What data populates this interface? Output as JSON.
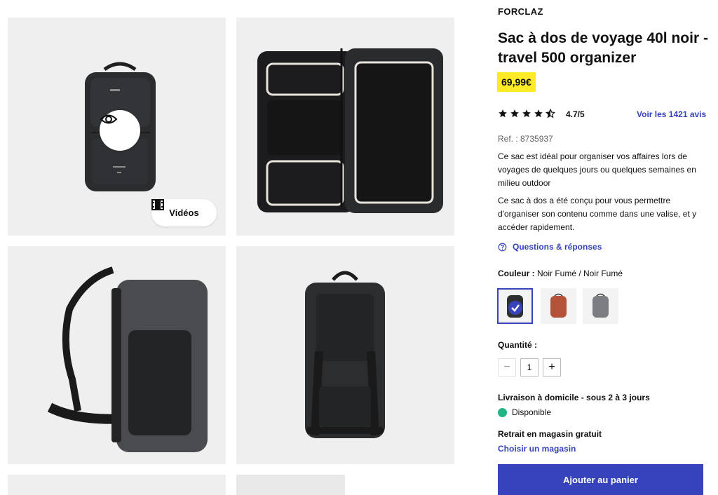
{
  "gallery": {
    "videos_label": "Vidéos"
  },
  "product": {
    "brand": "FORCLAZ",
    "title": "Sac à dos de voyage 40l noir - travel 500 organizer",
    "price": "69,99€",
    "rating": "4.7/5",
    "rating_value": 4.7,
    "rating_max": 5,
    "reviews_link": "Voir les 1421 avis",
    "ref": "Ref. : 8735937",
    "description_1": "Ce sac est idéal pour organiser vos affaires lors de voyages de quelques jours ou quelques semaines en milieu outdoor",
    "description_2": "Ce sac à dos a été conçu pour vous permettre d'organiser son contenu comme dans une valise, et y accéder rapidement.",
    "qa_link": "Questions & réponses"
  },
  "color": {
    "label": "Couleur :",
    "value": " Noir Fumé / Noir Fumé",
    "swatches": [
      {
        "name": "noir-fume",
        "color": "#2e2f31",
        "selected": true
      },
      {
        "name": "rouge-brique",
        "color": "#b5533a",
        "selected": false
      },
      {
        "name": "gris",
        "color": "#7b7d80",
        "selected": false
      }
    ]
  },
  "quantity": {
    "label": "Quantité :",
    "value": "1",
    "minus": "−",
    "plus": "+"
  },
  "delivery": {
    "home": "Livraison à domicile - sous 2 à 3 jours",
    "availability": "Disponible",
    "pickup": "Retrait en magasin gratuit",
    "choose_store": "Choisir un magasin"
  },
  "cart": {
    "label": "Ajouter au panier"
  },
  "colors": {
    "accent": "#3643ba",
    "price_bg": "#ffea28",
    "available": "#23b484"
  }
}
